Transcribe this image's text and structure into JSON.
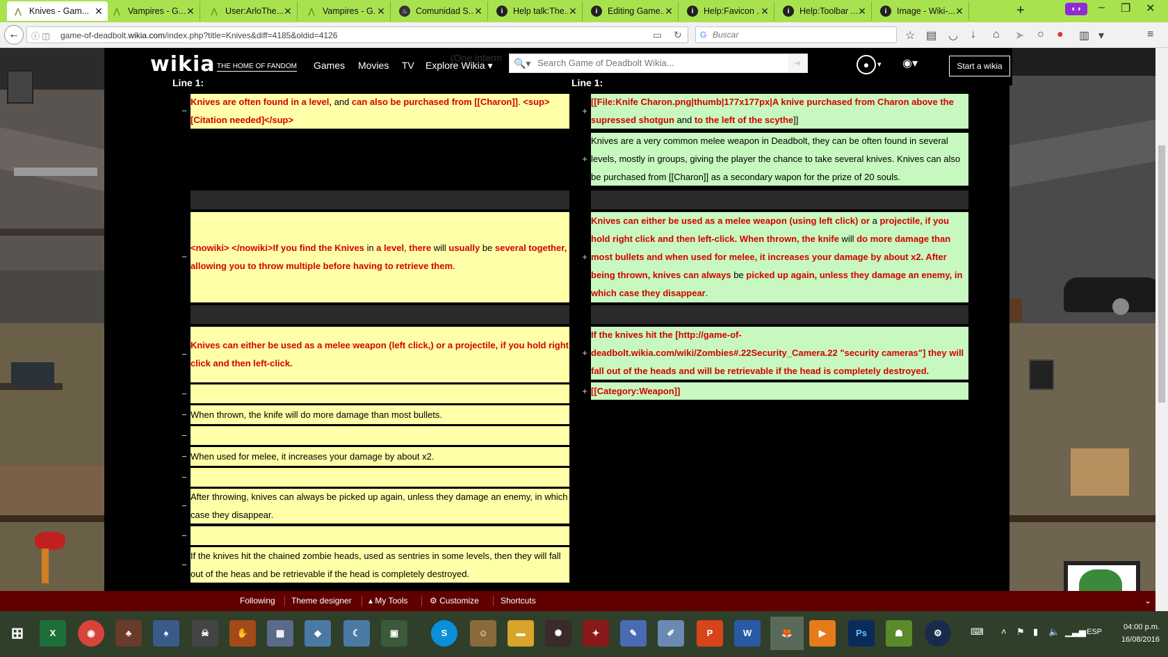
{
  "browser": {
    "tabs": [
      {
        "title": "Knives - Gam...",
        "icon": "wikia-icon",
        "active": true
      },
      {
        "title": "Vampires - G...",
        "icon": "wikia-icon"
      },
      {
        "title": "User:ArloThe...",
        "icon": "wikia-icon"
      },
      {
        "title": "Vampires - G...",
        "icon": "wikia-icon"
      },
      {
        "title": "Comunidad S...",
        "icon": "steam-icon"
      },
      {
        "title": "Help talk:The...",
        "icon": "help-wiki-icon"
      },
      {
        "title": "Editing Game...",
        "icon": "help-wiki-icon"
      },
      {
        "title": "Help:Favicon ...",
        "icon": "help-wiki-icon"
      },
      {
        "title": "Help:Toolbar ...",
        "icon": "help-wiki-icon"
      },
      {
        "title": "Image - Wiki-...",
        "icon": "help-wiki-icon"
      }
    ],
    "url_prefix": "game-of-deadbolt.",
    "url_domain": "wikia.com",
    "url_suffix": "/index.php?title=Knives&diff=4185&oldid=4126",
    "search_placeholder": "Buscar"
  },
  "wikia": {
    "logo": "wikia",
    "tagline": "THE HOME OF FANDOM",
    "nav": [
      "Games",
      "Movies",
      "TV",
      "Explore Wikia"
    ],
    "search_placeholder": "Search Game of Deadbolt Wikia...",
    "overlap_text": "(One interm",
    "start_button": "Start a wikia"
  },
  "diff": {
    "left_header": "Line 1:",
    "right_header": "Line 1:",
    "left_rows": [
      {
        "sign": "−",
        "segments": [
          {
            "t": "Knives are often found in a level,",
            "c": true
          },
          {
            "t": " and ",
            "c": false
          },
          {
            "t": "can also be purchased from [[Charon]]",
            "c": true
          },
          {
            "t": ". ",
            "c": false
          },
          {
            "t": "<sup>[Citation needed]</sup>",
            "c": true
          }
        ]
      },
      {
        "sign": "−",
        "segments": [
          {
            "t": "<nowiki> </nowiki>If you find the Knives",
            "c": true
          },
          {
            "t": " in ",
            "c": false
          },
          {
            "t": "a level",
            "c": true
          },
          {
            "t": ", ",
            "c": false
          },
          {
            "t": "there",
            "c": true
          },
          {
            "t": " will ",
            "c": false
          },
          {
            "t": "usually",
            "c": true
          },
          {
            "t": " be ",
            "c": false
          },
          {
            "t": "several together, allowing you to throw multiple before having to retrieve them",
            "c": true
          },
          {
            "t": ".",
            "c": false
          }
        ]
      },
      {
        "sign": "−",
        "segments": [
          {
            "t": "Knives can either be used as a melee weapon (left click,) or a projectile, if you hold right click and then left-click.",
            "c": true
          }
        ]
      },
      {
        "sign": "−",
        "segments": []
      },
      {
        "sign": "−",
        "segments": [
          {
            "t": "When thrown, the knife will do more damage than most bullets.",
            "c": false
          }
        ]
      },
      {
        "sign": "−",
        "segments": []
      },
      {
        "sign": "−",
        "segments": [
          {
            "t": "When used for melee, it increases your damage by about x2.",
            "c": false
          }
        ]
      },
      {
        "sign": "−",
        "segments": []
      },
      {
        "sign": "−",
        "segments": [
          {
            "t": "After throwing, knives can always be picked up again, unless they damage an enemy, in which case they disappear.",
            "c": false
          }
        ]
      },
      {
        "sign": "−",
        "segments": []
      },
      {
        "sign": "−",
        "segments": [
          {
            "t": "If the knives hit the chained zombie heads, used as sentries in some levels, then they will fall out of the heas and be retrievable if the head is completely destroyed.",
            "c": false
          }
        ]
      }
    ],
    "right_rows": [
      {
        "sign": "+",
        "segments": [
          {
            "t": "[[File:Knife Charon.png|thumb|177x177px|A knive purchased from Charon above the supressed shotgun",
            "c": true
          },
          {
            "t": " and ",
            "c": false
          },
          {
            "t": "to the left of the scythe",
            "c": true
          },
          {
            "t": "]]",
            "c": false
          }
        ]
      },
      {
        "sign": "+",
        "segments": [
          {
            "t": "Knives are a very common melee weapon in Deadbolt, they can be often found in several levels, mostly in groups, giving the player the chance to take several knives. Knives can also be purchased from [[Charon]] as a secondary wapon for the prize of 20 souls.",
            "c": false
          }
        ]
      },
      {
        "sign": "+",
        "segments": [
          {
            "t": "Knives can either be used as a melee weapon (using left click) or",
            "c": true
          },
          {
            "t": " a ",
            "c": false
          },
          {
            "t": "projectile, if you hold right click and then left-click. When thrown, the knife",
            "c": true
          },
          {
            "t": " will ",
            "c": false
          },
          {
            "t": "do more damage than most bullets and when used for melee, it increases your damage by about x2. After being thrown, knives can always",
            "c": true
          },
          {
            "t": " be ",
            "c": false
          },
          {
            "t": "picked up again, unless they damage an enemy, in which case they disappear",
            "c": true
          },
          {
            "t": ".",
            "c": false
          }
        ]
      },
      {
        "sign": "+",
        "segments": [
          {
            "t": "If the knives hit the [http://game-of-deadbolt.wikia.com/wiki/Zombies#.22Security_Camera.22 \"security cameras\"] they will fall out of the heads and will be retrievable if the head is completely destroyed.",
            "c": true
          }
        ]
      },
      {
        "sign": "+",
        "segments": [
          {
            "t": "[[Category:Weapon]]",
            "c": true
          }
        ]
      }
    ]
  },
  "toolbar": {
    "following": "Following",
    "theme_designer": "Theme designer",
    "my_tools": "My Tools",
    "customize": "Customize",
    "shortcuts": "Shortcuts"
  },
  "taskbar": {
    "language": "ESP",
    "time": "04:00 p.m.",
    "date": "16/08/2016"
  }
}
